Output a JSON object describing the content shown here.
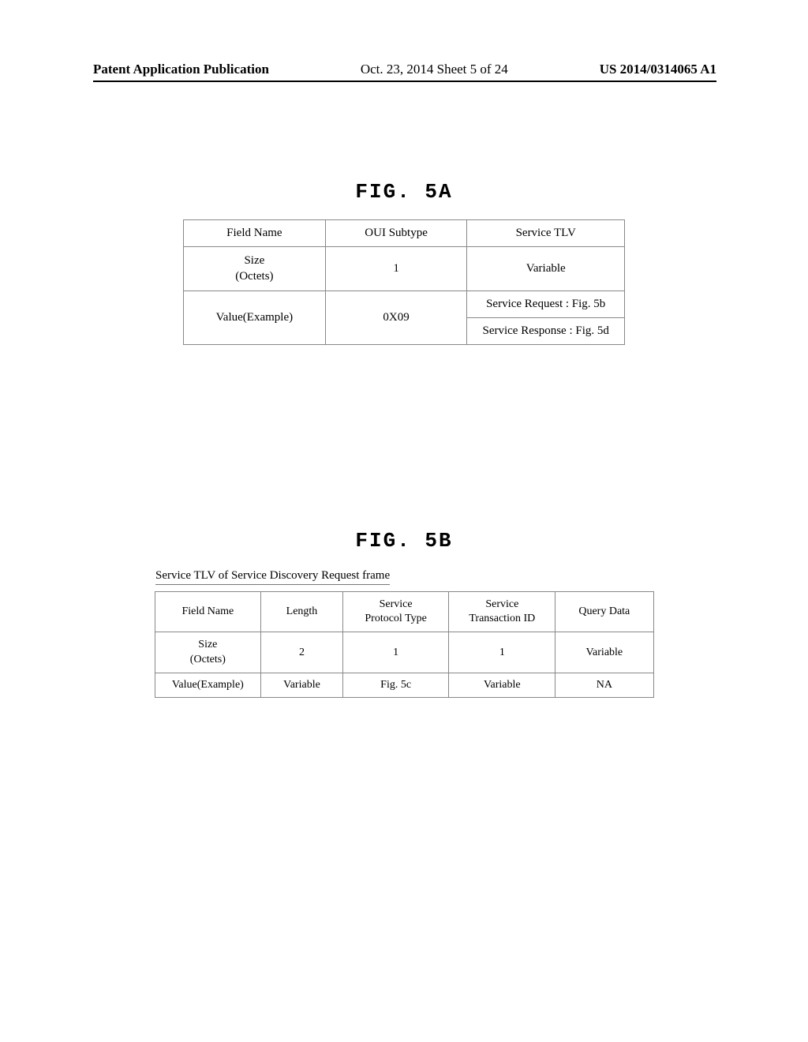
{
  "header": {
    "left": "Patent Application Publication",
    "center": "Oct. 23, 2014  Sheet 5 of 24",
    "right": "US 2014/0314065 A1"
  },
  "fig5a": {
    "title": "FIG. 5A",
    "row1": {
      "c1": "Field Name",
      "c2": "OUI Subtype",
      "c3": "Service TLV"
    },
    "row2": {
      "c1a": "Size",
      "c1b": "(Octets)",
      "c2": "1",
      "c3": "Variable"
    },
    "row3": {
      "c1": "Value(Example)",
      "c2": "0X09",
      "c3a": "Service Request : Fig. 5b",
      "c3b": "Service Response : Fig. 5d"
    }
  },
  "fig5b": {
    "title": "FIG. 5B",
    "caption": "Service TLV of Service Discovery Request frame",
    "row1": {
      "c1": "Field Name",
      "c2": "Length",
      "c3a": "Service",
      "c3b": "Protocol Type",
      "c4a": "Service",
      "c4b": "Transaction ID",
      "c5": "Query Data"
    },
    "row2": {
      "c1a": "Size",
      "c1b": "(Octets)",
      "c2": "2",
      "c3": "1",
      "c4": "1",
      "c5": "Variable"
    },
    "row3": {
      "c1": "Value(Example)",
      "c2": "Variable",
      "c3": "Fig. 5c",
      "c4": "Variable",
      "c5": "NA"
    }
  }
}
